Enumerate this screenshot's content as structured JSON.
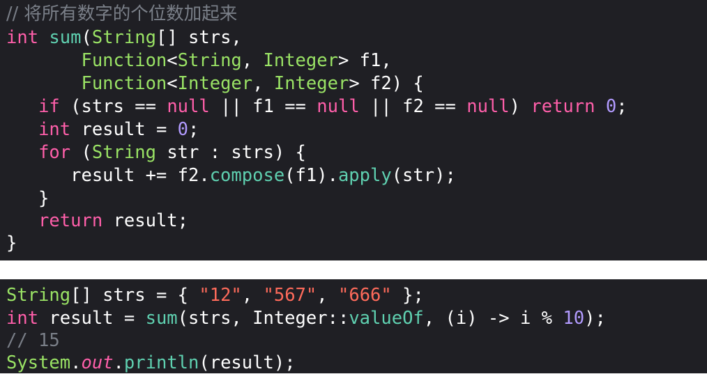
{
  "snippet1": {
    "comment": "// 将所有数字的个位数加起来",
    "int_kw": "int",
    "sum_fn": "sum",
    "String_ty": "String",
    "params_rest": "[] strs,",
    "Function_ty": "Function",
    "Integer_ty": "Integer",
    "f1_rest": "> f1,",
    "f2_rest": "> f2) {",
    "if_kw": "if",
    "null_kw": "null",
    "return_kw": "return",
    "zero": "0",
    "for_kw": "for",
    "compose_fn": "compose",
    "apply_fn": "apply"
  },
  "snippet2": {
    "String_ty": "String",
    "s12": "\"12\"",
    "s567": "\"567\"",
    "s666": "\"666\"",
    "int_kw": "int",
    "sum_fn": "sum",
    "Integer_plain": "Integer",
    "valueOf_fn": "valueOf",
    "ten": "10",
    "comment": "// 15",
    "System_ty": "System",
    "out_kw": "out",
    "println_fn": "println"
  },
  "colors": {
    "background": "#1f1f24",
    "keyword": "#ff5faa",
    "type": "#9ae365",
    "function": "#5fd0b0",
    "number": "#b29bff",
    "string": "#ff6b5b",
    "comment": "#7a7f88",
    "plain": "#ffffff"
  }
}
